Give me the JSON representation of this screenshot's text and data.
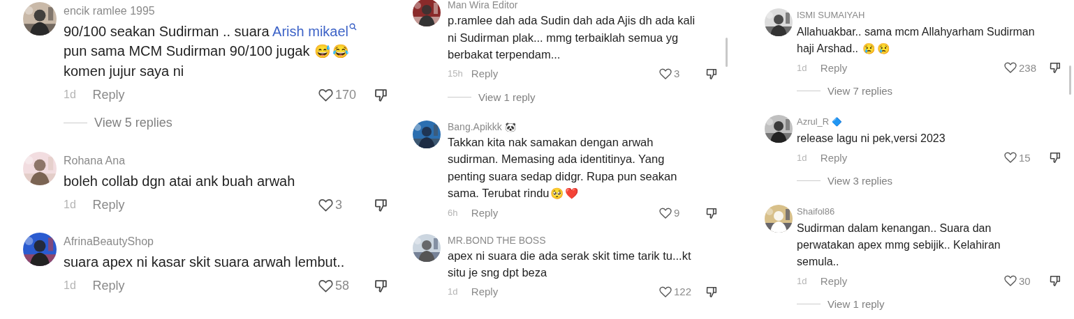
{
  "columns": [
    {
      "comments": [
        {
          "user": "encik ramlee 1995",
          "text": [
            {
              "kind": "plain",
              "text": "90/100 seakan Sudirman .. suara "
            },
            {
              "kind": "mention",
              "text": "Arish mikael"
            },
            {
              "kind": "plain",
              "text": " pun sama MCM Sudirman 90/100 jugak "
            },
            {
              "kind": "emoji",
              "text": "😅"
            },
            {
              "kind": "emoji",
              "text": "😂"
            },
            {
              "kind": "plain",
              "text": " komen jujur saya ni"
            }
          ],
          "time": "1d",
          "reply": "Reply",
          "likes": "170",
          "view_replies": "View 5 replies"
        },
        {
          "user": "Rohana Ana",
          "text": [
            {
              "kind": "plain",
              "text": "boleh collab dgn atai ank buah arwah"
            }
          ],
          "time": "1d",
          "reply": "Reply",
          "likes": "3"
        },
        {
          "user": "AfrinaBeautyShop",
          "text": [
            {
              "kind": "plain",
              "text": "suara apex ni kasar skit suara arwah lembut.."
            }
          ],
          "time": "1d",
          "reply": "Reply",
          "likes": "58"
        }
      ]
    },
    {
      "comments": [
        {
          "user": "Man Wira Editor",
          "text": [
            {
              "kind": "plain",
              "text": "p.ramlee dah ada Sudin dah ada Ajis dh ada kali ni Sudirman plak... mmg terbaiklah semua yg berbakat terpendam..."
            }
          ],
          "time": "15h",
          "reply": "Reply",
          "likes": "3",
          "view_replies": "View 1 reply"
        },
        {
          "user": "Bang.Apikkk",
          "badge": "🐼",
          "text": [
            {
              "kind": "plain",
              "text": "Takkan kita nak samakan dengan arwah sudirman. Memasing ada identitinya. Yang penting suara sedap didgr. Rupa pun seakan sama. Terubat rindu"
            },
            {
              "kind": "emoji",
              "text": "🥺"
            },
            {
              "kind": "emoji",
              "text": "❤️"
            }
          ],
          "time": "6h",
          "reply": "Reply",
          "likes": "9"
        },
        {
          "user": "MR.BOND THE BOSS",
          "text": [
            {
              "kind": "plain",
              "text": "apex ni suara die ada serak skit time tarik tu...kt situ je sng dpt beza"
            }
          ],
          "time": "1d",
          "reply": "Reply",
          "likes": "122"
        }
      ]
    },
    {
      "comments": [
        {
          "user": "ISMI SUMAIYAH",
          "text": [
            {
              "kind": "plain",
              "text": "Allahuakbar.. sama mcm Allahyarham Sudirman haji Arshad.. "
            },
            {
              "kind": "emoji",
              "text": "😢"
            },
            {
              "kind": "emoji",
              "text": "😢"
            }
          ],
          "time": "1d",
          "reply": "Reply",
          "likes": "238",
          "view_replies": "View 7 replies"
        },
        {
          "user": "Azrul_R",
          "badge": "🔷",
          "text": [
            {
              "kind": "plain",
              "text": "release lagu ni pek,versi 2023"
            }
          ],
          "time": "1d",
          "reply": "Reply",
          "likes": "15",
          "view_replies": "View 3 replies"
        },
        {
          "user": "Shaifol86",
          "text": [
            {
              "kind": "plain",
              "text": "Sudirman dalam kenangan.. Suara dan perwatakan apex mmg sebijik.. Kelahiran semula.."
            }
          ],
          "time": "1d",
          "reply": "Reply",
          "likes": "30",
          "view_replies": "View 1 reply"
        }
      ]
    }
  ]
}
